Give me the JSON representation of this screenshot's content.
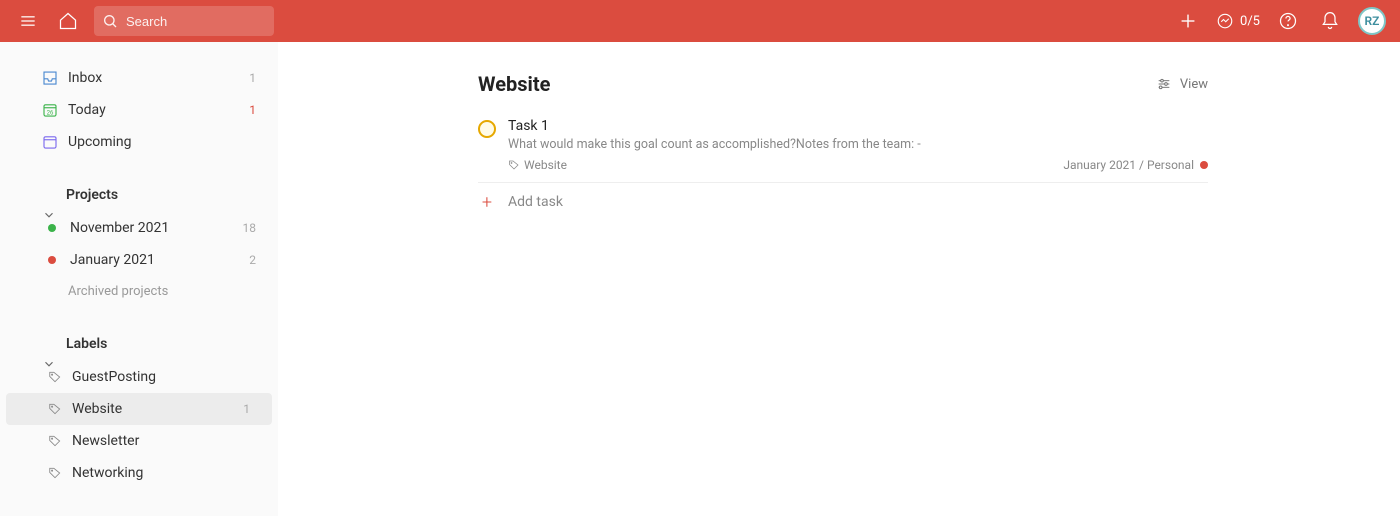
{
  "header": {
    "search_placeholder": "Search",
    "productivity": "0/5",
    "avatar_initials": "RZ"
  },
  "sidebar": {
    "nav": [
      {
        "key": "inbox",
        "label": "Inbox",
        "count": "1",
        "count_red": false
      },
      {
        "key": "today",
        "label": "Today",
        "count": "1",
        "count_red": true
      },
      {
        "key": "upcoming",
        "label": "Upcoming",
        "count": "",
        "count_red": false
      }
    ],
    "projects_header": "Projects",
    "projects": [
      {
        "label": "November 2021",
        "count": "18",
        "color": "#3bb34a"
      },
      {
        "label": "January 2021",
        "count": "2",
        "color": "#db4c3f"
      }
    ],
    "archived": "Archived projects",
    "labels_header": "Labels",
    "labels": [
      {
        "label": "GuestPosting",
        "count": "",
        "active": false
      },
      {
        "label": "Website",
        "count": "1",
        "active": true
      },
      {
        "label": "Newsletter",
        "count": "",
        "active": false
      },
      {
        "label": "Networking",
        "count": "",
        "active": false
      }
    ]
  },
  "main": {
    "title": "Website",
    "view_label": "View",
    "task": {
      "title": "Task 1",
      "desc": "What would make this goal count as accomplished?Notes from the team: -",
      "label": "Website",
      "project": "January 2021 / Personal"
    },
    "add_task": "Add task"
  }
}
